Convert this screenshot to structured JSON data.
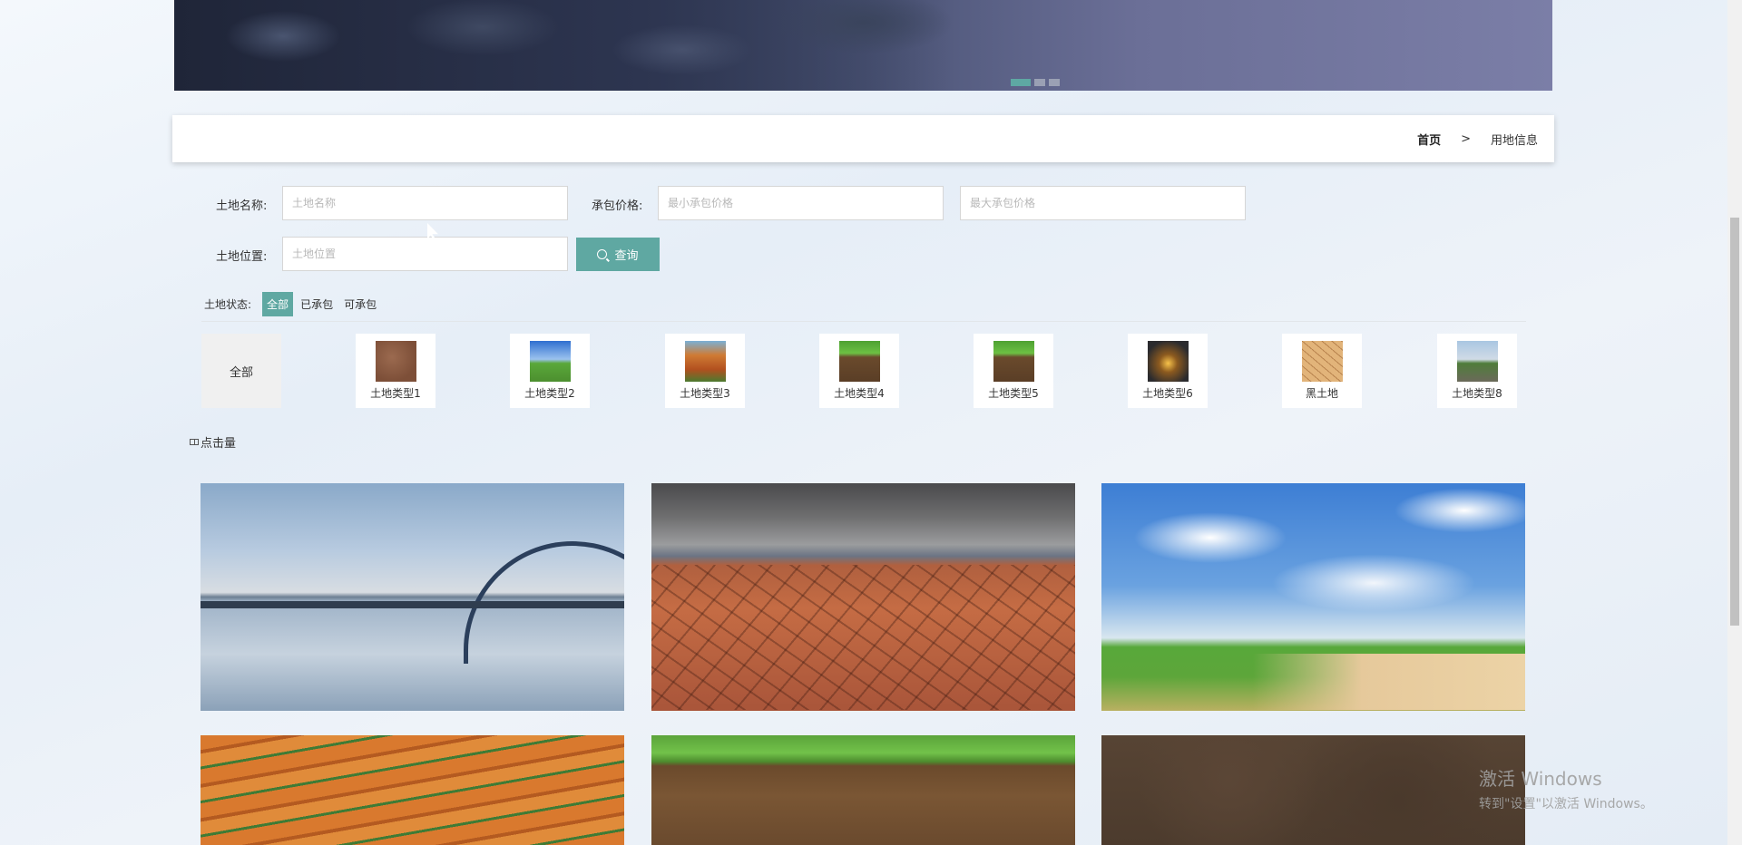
{
  "banner": {
    "dots": 3,
    "active_dot": 1
  },
  "breadcrumb": {
    "home": "首页",
    "separator": ">",
    "current": "用地信息"
  },
  "search": {
    "land_name_label": "土地名称:",
    "land_name_placeholder": "土地名称",
    "price_label": "承包价格:",
    "min_price_placeholder": "最小承包价格",
    "max_price_placeholder": "最大承包价格",
    "location_label": "土地位置:",
    "location_placeholder": "土地位置",
    "query_button": "查询"
  },
  "status": {
    "label": "土地状态:",
    "options": [
      "全部",
      "已承包",
      "可承包"
    ],
    "selected": "全部"
  },
  "categories": {
    "all_label": "全部",
    "items": [
      {
        "label": "土地类型1",
        "icon": "soil-thumbnail"
      },
      {
        "label": "土地类型2",
        "icon": "field-thumbnail"
      },
      {
        "label": "土地类型3",
        "icon": "red-earth-thumbnail"
      },
      {
        "label": "土地类型4",
        "icon": "grass-soil-thumbnail"
      },
      {
        "label": "土地类型5",
        "icon": "grass-soil-thumbnail"
      },
      {
        "label": "土地类型6",
        "icon": "sunset-field-thumbnail"
      },
      {
        "label": "黑土地",
        "icon": "cracked-earth-thumbnail"
      },
      {
        "label": "土地类型8",
        "icon": "plain-thumbnail"
      }
    ]
  },
  "sort": {
    "label": "点击量"
  },
  "watermark": {
    "line1": "激活 Windows",
    "line2": "转到\"设置\"以激活 Windows。"
  },
  "colors": {
    "accent": "#5fa8a2",
    "breadcrumb_bg": "#ffffff"
  }
}
